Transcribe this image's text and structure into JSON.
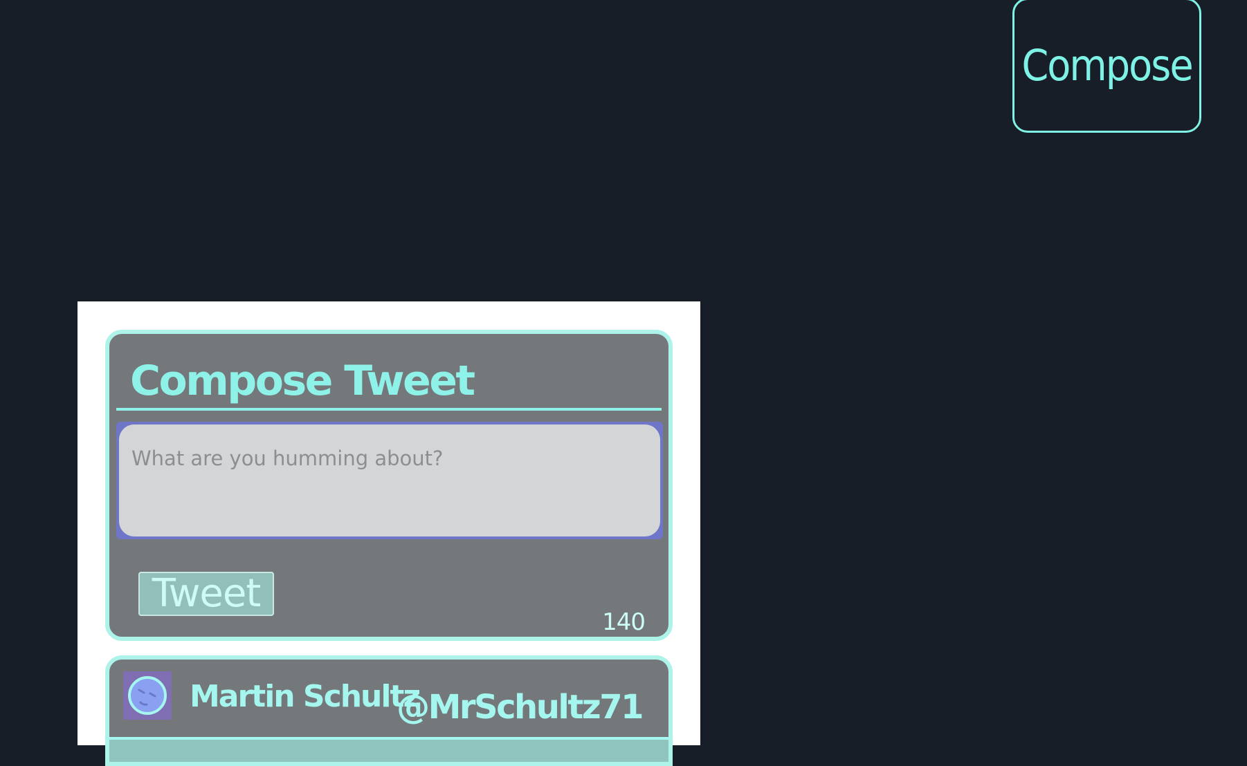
{
  "nav": {
    "compose_label": "Compose"
  },
  "composer": {
    "title": "Compose Tweet",
    "input_placeholder": "What are you humming about?",
    "input_value": "",
    "tweet_button_label": "Tweet",
    "char_count": "140"
  },
  "tweets": [
    {
      "author_name": "Martin Schultz",
      "author_handle": "@MrSchultz71",
      "avatar_icon": "face-avatar-icon"
    }
  ],
  "colors": {
    "background": "#181e28",
    "accent": "#7ff2e6",
    "card": "#75787b",
    "panel": "#ffffff",
    "input_focus": "#6f76c8"
  }
}
